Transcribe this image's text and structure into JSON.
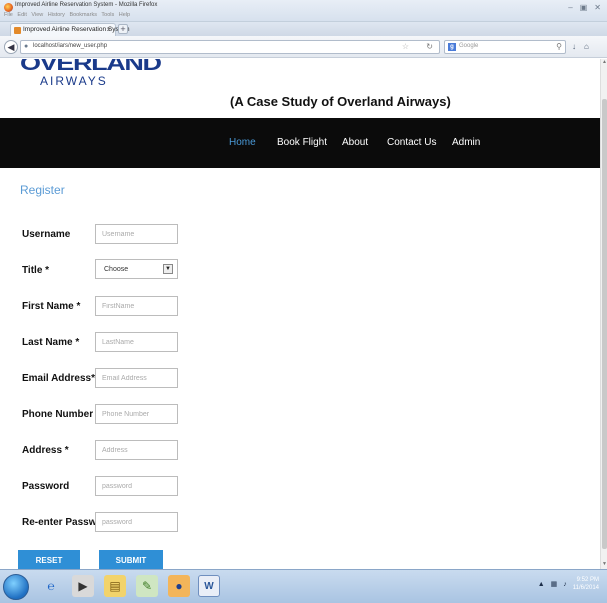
{
  "window": {
    "title": "Improved Airline Reservation System - Mozilla Firefox",
    "menu": [
      "File",
      "Edit",
      "View",
      "History",
      "Bookmarks",
      "Tools",
      "Help"
    ]
  },
  "tab": {
    "label": "Improved Airline Reservation System"
  },
  "address": {
    "url": "localhost/iars/new_user.php"
  },
  "search": {
    "engine": "Google"
  },
  "site": {
    "logo_top": "OVERLAND",
    "logo_bottom": "AIRWAYS",
    "subtitle": "(A Case Study of Overland Airways)"
  },
  "nav": {
    "items": [
      {
        "label": "Home",
        "active": true
      },
      {
        "label": "Book Flight"
      },
      {
        "label": "About"
      },
      {
        "label": "Contact Us"
      },
      {
        "label": "Admin"
      }
    ]
  },
  "form": {
    "title": "Register",
    "username": {
      "label": "Username",
      "placeholder": "Username"
    },
    "title_field": {
      "label": "Title *",
      "value": "Choose"
    },
    "first_name": {
      "label": "First Name *",
      "placeholder": "FirstName"
    },
    "last_name": {
      "label": "Last Name *",
      "placeholder": "LastName"
    },
    "email": {
      "label": "Email Address*",
      "placeholder": "Email Address"
    },
    "phone": {
      "label": "Phone Number *",
      "placeholder": "Phone Number"
    },
    "address": {
      "label": "Address *",
      "placeholder": "Address"
    },
    "password": {
      "label": "Password",
      "placeholder": "password"
    },
    "reenter": {
      "label": "Re-enter Password",
      "placeholder": "password"
    },
    "reset_label": "RESET",
    "submit_label": "SUBMIT"
  },
  "taskbar": {
    "time": "9:52 PM",
    "date": "11/6/2014"
  }
}
